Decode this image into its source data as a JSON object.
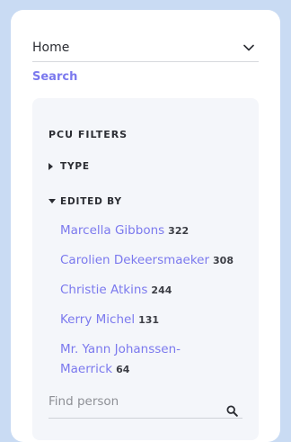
{
  "nav": {
    "selected": "Home"
  },
  "search_link": "Search",
  "filters": {
    "title": "PCU FILTERS",
    "groups": [
      {
        "label": "TYPE",
        "expanded": false
      },
      {
        "label": "EDITED BY",
        "expanded": true
      }
    ],
    "people": [
      {
        "name": "Marcella Gibbons",
        "count": "322"
      },
      {
        "name": "Carolien Dekeersmaeker",
        "count": "308"
      },
      {
        "name": "Christie Atkins",
        "count": "244"
      },
      {
        "name": "Kerry Michel",
        "count": "131"
      },
      {
        "name": "Mr. Yann Johanssen-Maerrick",
        "count": "64"
      }
    ],
    "find_placeholder": "Find person"
  },
  "colors": {
    "accent": "#7b79ee",
    "background": "#c9dbf3",
    "card": "#f4f6fa"
  },
  "icons": [
    "chevron-down-icon",
    "caret-right-icon",
    "caret-down-icon",
    "search-icon"
  ]
}
